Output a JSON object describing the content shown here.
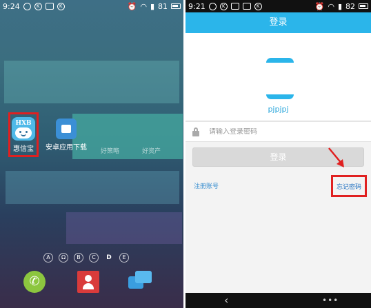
{
  "left_phone": {
    "status": {
      "time": "9:24",
      "battery": "81"
    },
    "apps": [
      {
        "label": "惠信宝",
        "icon": "hxb-app-icon",
        "icon_text": "HXB"
      },
      {
        "label": "安卓应用下载",
        "icon": "store-app-icon"
      }
    ],
    "faded_labels": [
      "好策略",
      "好资产"
    ],
    "page_indicators": [
      "A",
      "Ω",
      "B",
      "C",
      "D",
      "E"
    ],
    "dock": [
      "phone-icon",
      "contacts-icon",
      "messages-icon"
    ],
    "colors": {
      "highlight": "#e02020",
      "hxb_blue": "#4fb9e8"
    }
  },
  "right_phone": {
    "status": {
      "time": "9:21",
      "battery": "82"
    },
    "title": "登录",
    "username": "pjpjpj",
    "password_placeholder": "请输入登录密码",
    "login_button": "登录",
    "register_link": "注册账号",
    "forgot_link": "忘记密码",
    "nav": {
      "back": "‹",
      "menu": "•••"
    },
    "colors": {
      "accent": "#2bb5ea",
      "highlight": "#e02020"
    }
  }
}
